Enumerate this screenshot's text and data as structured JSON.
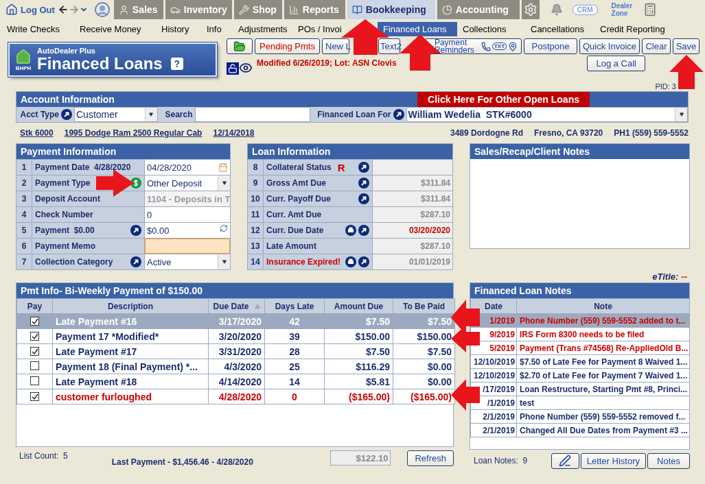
{
  "nav": {
    "logout": "Log Out",
    "modules": [
      {
        "label": "Sales",
        "selected": false
      },
      {
        "label": "Inventory",
        "selected": false
      },
      {
        "label": "Shop",
        "selected": false
      },
      {
        "label": "Reports",
        "selected": false
      },
      {
        "label": "Bookkeeping",
        "selected": true
      },
      {
        "label": "Accounting",
        "selected": false
      }
    ],
    "crm": "CRM",
    "dealer_zone": "Dealer Zone"
  },
  "menu": [
    {
      "label": "Write Checks",
      "selected": false
    },
    {
      "label": "Receive Money",
      "selected": false
    },
    {
      "label": "History",
      "selected": false
    },
    {
      "label": "Info",
      "selected": false
    },
    {
      "label": "Adjustments",
      "selected": false
    },
    {
      "label": "POs / Invoi",
      "selected": false
    },
    {
      "label": "Financed Loans",
      "selected": true
    },
    {
      "label": "Collections",
      "selected": false
    },
    {
      "label": "Cancellations",
      "selected": false
    },
    {
      "label": "Credit Reporting",
      "selected": false
    }
  ],
  "logo": {
    "brand": "AutoDealer Plus",
    "badge": "BHPH",
    "title": "Financed Loans",
    "help": "?"
  },
  "toolbar": [
    {
      "kind": "folder"
    },
    {
      "kind": "alert",
      "label": "Pending Pmts"
    },
    {
      "kind": "plain",
      "label": "New L"
    },
    {
      "kind": "plain",
      "label": "Text2"
    },
    {
      "kind": "reminders",
      "label": "Payment Reminders",
      "badge": "TXT"
    },
    {
      "kind": "plain",
      "label": "Postpone"
    },
    {
      "kind": "plain",
      "label": "Quick Invoice"
    },
    {
      "kind": "plain",
      "label": "Clear"
    },
    {
      "kind": "plain",
      "label": "Save"
    }
  ],
  "log_call": "Log a Call",
  "modified": "Modified 6/26/2019; Lot: ASN Clovis",
  "pid": "PID: 3",
  "account": {
    "title": "Account Information",
    "other_loans": "Click Here For Other Open Loans",
    "acct_type_label": "Acct Type",
    "acct_type": "Customer",
    "search_label": "Search",
    "for_label": "Financed Loan For",
    "for_value": "William Wedelia  STK#6000"
  },
  "vehicle": {
    "stock": "Stk 6000",
    "model": "1995 Dodge Ram 2500 Regular Cab",
    "date": "12/14/2018",
    "address": "3489 Dordogne Rd",
    "city": "Fresno, CA 93720",
    "phone": "PH1 (559) 559-5552"
  },
  "payment_info": {
    "title": "Payment Information",
    "rows": [
      {
        "num": "1",
        "label": "Payment Date  4/28/2020",
        "kind": "date",
        "value": "04/28/2020"
      },
      {
        "num": "2",
        "label": "Payment Type",
        "kind": "select",
        "value": "Other Deposit"
      },
      {
        "num": "3",
        "label": "Deposit Account",
        "kind": "readonly",
        "value": "1104 - Deposits in T"
      },
      {
        "num": "4",
        "label": "Check Number",
        "kind": "text",
        "value": "0"
      },
      {
        "num": "5",
        "label": "Payment  $0.00",
        "kind": "amount",
        "value": "$0.00"
      },
      {
        "num": "6",
        "label": "Payment Memo",
        "kind": "memo"
      },
      {
        "num": "7",
        "label": "Collection Category",
        "kind": "select",
        "value": "Active"
      }
    ]
  },
  "loan_info": {
    "title": "Loan Information",
    "rows": [
      {
        "num": "8",
        "label": "Collateral Status",
        "flag": "R",
        "alert": false
      },
      {
        "num": "9",
        "label": "Gross Amt Due",
        "value": "$311.84",
        "alert": false
      },
      {
        "num": "10",
        "label": "Curr. Payoff Due",
        "value": "$311.84",
        "alert": false
      },
      {
        "num": "11",
        "label": "Curr. Amt Due",
        "value": "$287.10",
        "alert": false
      },
      {
        "num": "12",
        "label": "Curr. Due Date",
        "value": "03/20/2020",
        "alert": false,
        "value_alert": true
      },
      {
        "num": "13",
        "label": "Late Amount",
        "value": "$287.10",
        "alert": false
      },
      {
        "num": "14",
        "label": "Insurance Expired!",
        "value": "01/01/2019",
        "alert": true
      }
    ]
  },
  "sales_notes": {
    "title": "Sales/Recap/Client Notes"
  },
  "etitle": {
    "label": "eTitle:",
    "value": "--"
  },
  "payments": {
    "title": "Pmt Info- Bi-Weekly Payment of $150.00",
    "pay_column": "Pay",
    "columns": [
      {
        "label": "Description",
        "sorted": false
      },
      {
        "label": "Due Date",
        "sorted": true
      },
      {
        "label": "Days Late",
        "sorted": false
      },
      {
        "label": "Amount Due",
        "sorted": false
      },
      {
        "label": "To Be Paid",
        "sorted": false
      }
    ],
    "rows": [
      {
        "checked": true,
        "selected": true,
        "alert": false,
        "cells": [
          "Late Payment #16",
          "3/17/2020",
          "42",
          "$7.50",
          "$7.50"
        ]
      },
      {
        "checked": true,
        "selected": false,
        "alert": false,
        "cells": [
          "Payment 17 *Modified*",
          "3/20/2020",
          "39",
          "$150.00",
          "$150.00"
        ]
      },
      {
        "checked": true,
        "selected": false,
        "alert": false,
        "cells": [
          "Late Payment #17",
          "3/31/2020",
          "28",
          "$7.50",
          "$7.50"
        ]
      },
      {
        "checked": false,
        "selected": false,
        "alert": false,
        "cells": [
          "Payment 18 (Final Payment) *...",
          "4/3/2020",
          "25",
          "$116.29",
          "$0.00"
        ]
      },
      {
        "checked": false,
        "selected": false,
        "alert": false,
        "cells": [
          "Late Payment #18",
          "4/14/2020",
          "14",
          "$5.81",
          "$0.00"
        ]
      },
      {
        "checked": true,
        "selected": false,
        "alert": true,
        "cells": [
          "customer furloughed",
          "4/28/2020",
          "0",
          "($165.00)",
          "($165.00)"
        ]
      }
    ],
    "list_count": "List Count:  5",
    "last_payment": "Last Payment - $1,456.46 - 4/28/2020",
    "total": "$122.10",
    "refresh": "Refresh"
  },
  "notes": {
    "title": "Financed Loan Notes",
    "columns": [
      "Date",
      "Note"
    ],
    "rows": [
      {
        "date": "1/2019",
        "note": "Phone Number (559) 559-5552 added to t...",
        "selected": true,
        "alert": true
      },
      {
        "date": "9/2019",
        "note": "IRS Form 8300 needs to be filed",
        "selected": false,
        "alert": true
      },
      {
        "date": "5/2019",
        "note": "Payment (Trans #74568) Re-AppliedOld B...",
        "selected": false,
        "alert": true
      },
      {
        "date": "12/10/2019",
        "note": "$7.50 of Late Fee for Payment 8 Waived 1...",
        "selected": false,
        "alert": false
      },
      {
        "date": "12/10/2019",
        "note": "$2.70 of Late Fee for Payment 7 Waived 1...",
        "selected": false,
        "alert": false
      },
      {
        "date": "/17/2019",
        "note": "Loan Restructure, Starting Pmt #8, Princi...",
        "selected": false,
        "alert": false
      },
      {
        "date": "/1/2019",
        "note": "test",
        "selected": false,
        "alert": false
      },
      {
        "date": "2/1/2019",
        "note": "Phone Number (559) 559-5552 removed f...",
        "selected": false,
        "alert": false
      },
      {
        "date": "2/1/2019",
        "note": "Changed All Due Dates from Payment #3 ...",
        "selected": false,
        "alert": false
      }
    ],
    "count": "Loan Notes:  9",
    "buttons": [
      "Letter History",
      "Notes"
    ]
  }
}
